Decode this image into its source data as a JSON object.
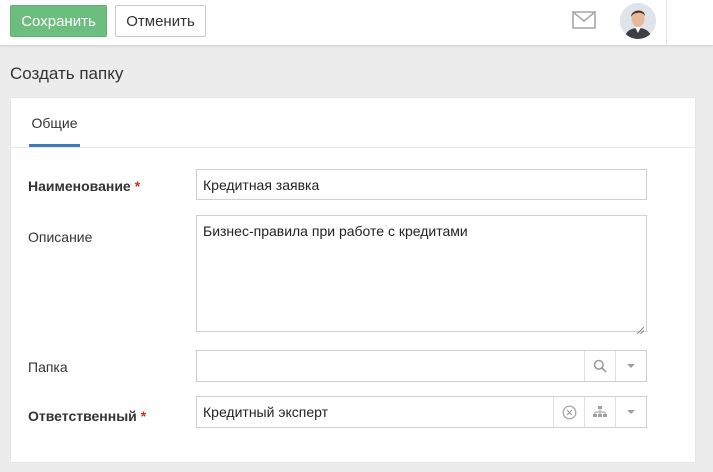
{
  "toolbar": {
    "save_label": "Сохранить",
    "cancel_label": "Отменить",
    "mail_icon": "mail-icon",
    "avatar_icon": "user-avatar"
  },
  "page": {
    "title": "Создать папку"
  },
  "tabs": [
    {
      "label": "Общие",
      "active": true
    }
  ],
  "form": {
    "name": {
      "label": "Наименование",
      "required_mark": "*",
      "value": "Кредитная заявка"
    },
    "description": {
      "label": "Описание",
      "value": "Бизнес-правила при работе с кредитами"
    },
    "folder": {
      "label": "Папка",
      "value": ""
    },
    "responsible": {
      "label": "Ответственный",
      "required_mark": "*",
      "value": "Кредитный эксперт"
    }
  },
  "colors": {
    "save_button": "#6cbd7e",
    "active_tab": "#3d7ab8",
    "required": "#d52a2a"
  }
}
